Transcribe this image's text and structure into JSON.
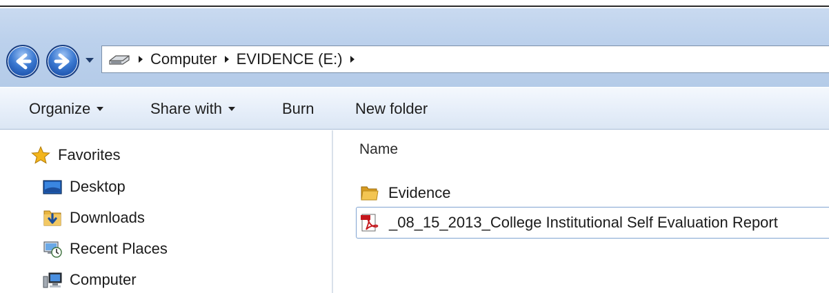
{
  "address_bar": {
    "breadcrumbs": [
      "Computer",
      "EVIDENCE (E:)"
    ],
    "icon": "drive-icon"
  },
  "toolbar": {
    "organize_label": "Organize",
    "share_label": "Share with",
    "burn_label": "Burn",
    "new_folder_label": "New folder"
  },
  "nav_pane": {
    "favorites_label": "Favorites",
    "items": [
      {
        "label": "Desktop",
        "icon": "desktop-icon"
      },
      {
        "label": "Downloads",
        "icon": "downloads-icon"
      },
      {
        "label": "Recent Places",
        "icon": "recent-places-icon"
      },
      {
        "label": "Computer",
        "icon": "computer-icon"
      }
    ]
  },
  "content": {
    "column_header": "Name",
    "files": [
      {
        "name": "Evidence",
        "icon": "folder-icon",
        "selected": false
      },
      {
        "name": "_08_15_2013_College Institutional Self Evaluation Report",
        "icon": "pdf-icon",
        "selected": true
      }
    ]
  },
  "colors": {
    "address_band": "#bcd1ec",
    "toolbar": "#e6eef9",
    "nav_button": "#3a78d0",
    "selection_border": "#7fa3d1"
  }
}
